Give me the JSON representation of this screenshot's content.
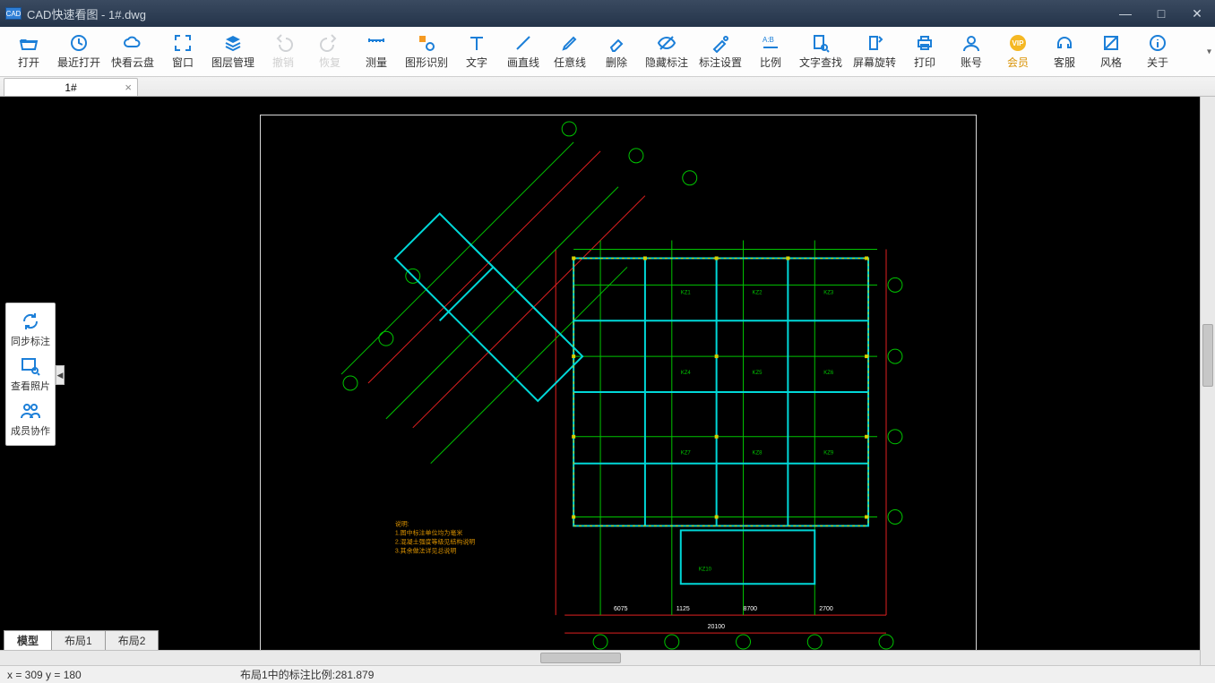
{
  "window": {
    "title": "CAD快速看图 - 1#.dwg"
  },
  "toolbar": [
    {
      "id": "open",
      "label": "打开"
    },
    {
      "id": "recent",
      "label": "最近打开"
    },
    {
      "id": "cloud",
      "label": "快看云盘"
    },
    {
      "id": "window",
      "label": "窗口"
    },
    {
      "id": "layers",
      "label": "图层管理"
    },
    {
      "id": "undo",
      "label": "撤销",
      "disabled": true
    },
    {
      "id": "redo",
      "label": "恢复",
      "disabled": true
    },
    {
      "id": "measure",
      "label": "测量"
    },
    {
      "id": "shape-rec",
      "label": "图形识别"
    },
    {
      "id": "text",
      "label": "文字"
    },
    {
      "id": "line",
      "label": "画直线"
    },
    {
      "id": "freeline",
      "label": "任意线"
    },
    {
      "id": "delete",
      "label": "删除"
    },
    {
      "id": "hide-annot",
      "label": "隐藏标注"
    },
    {
      "id": "annot-setting",
      "label": "标注设置"
    },
    {
      "id": "scale",
      "label": "比例"
    },
    {
      "id": "find-text",
      "label": "文字查找"
    },
    {
      "id": "rotate",
      "label": "屏幕旋转"
    },
    {
      "id": "print",
      "label": "打印"
    },
    {
      "id": "account",
      "label": "账号"
    },
    {
      "id": "vip",
      "label": "会员",
      "vip": true
    },
    {
      "id": "support",
      "label": "客服"
    },
    {
      "id": "style",
      "label": "风格"
    },
    {
      "id": "about",
      "label": "关于"
    }
  ],
  "fileTabs": [
    {
      "label": "1#",
      "active": true
    }
  ],
  "sidePanel": [
    {
      "id": "sync",
      "label": "同步标注"
    },
    {
      "id": "photos",
      "label": "查看照片"
    },
    {
      "id": "members",
      "label": "成员协作"
    }
  ],
  "layoutTabs": [
    {
      "label": "模型",
      "active": true
    },
    {
      "label": "布局1"
    },
    {
      "label": "布局2"
    }
  ],
  "status": {
    "coords": "x = 309  y = 180",
    "ratio": "布局1中的标注比例:281.879"
  }
}
